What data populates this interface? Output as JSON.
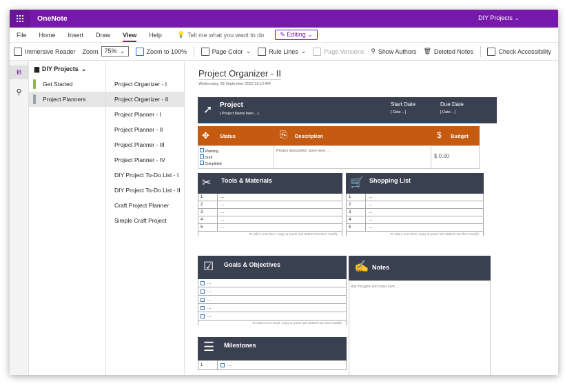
{
  "app": {
    "title": "OneNote",
    "notebook_switch": "DIY Projects"
  },
  "menu": {
    "items": [
      "File",
      "Home",
      "Insert",
      "Draw",
      "View",
      "Help"
    ],
    "active": "View",
    "tellme": "Tell me what you want to do",
    "editing": "Editing"
  },
  "toolbar": {
    "immersive": "Immersive Reader",
    "zoom_label": "Zoom",
    "zoom_value": "75%",
    "zoom100": "Zoom to 100%",
    "page_color": "Page Color",
    "rule_lines": "Rule Lines",
    "page_versions": "Page Versions",
    "show_authors": "Show Authors",
    "deleted_notes": "Deleted Notes",
    "check_access": "Check Accessibility"
  },
  "notebook": {
    "name": "DIY Projects"
  },
  "sections": [
    {
      "label": "Get Started",
      "color": "#8bbd3c"
    },
    {
      "label": "Project Planners",
      "color": "#9aa4b0"
    }
  ],
  "pages": [
    "Project Organizer - I",
    "Project Organizer - II",
    "Project Planner - I",
    "Project Planner - II",
    "Project Planner - III",
    "Project Planner - IV",
    "DIY Project To-Do List - I",
    "DIY Project To-Do List - II",
    "Craft Project Planner",
    "Simple Craft Project"
  ],
  "page": {
    "title": "Project Organizer - II",
    "date": "Wednesday, 28 September 2022    10:12 AM",
    "project": {
      "label": "Project",
      "name_ph": "[ Project Name here .. ]",
      "start_label": "Start Date",
      "start_ph": "[ Date .. ]",
      "due_label": "Due Date",
      "due_ph": "[ Date .. ]"
    },
    "status": {
      "label": "Status",
      "options": [
        "Planning",
        "Draft",
        "Completed"
      ]
    },
    "description": {
      "label": "Description",
      "ph": "Project description goes here ..."
    },
    "budget": {
      "label": "Budget",
      "value": "$ 0.00"
    },
    "tools": {
      "label": "Tools & Materials",
      "rows": [
        "1",
        "2",
        "3",
        "4",
        "5"
      ],
      "tip": "To add a new item: Copy & paste last dotted row then modify"
    },
    "shopping": {
      "label": "Shopping List",
      "rows": [
        "1",
        "2",
        "3",
        "4",
        "5"
      ],
      "tip": "To add a new item: Copy & paste last dotted row then modify"
    },
    "goals": {
      "label": "Goals & Objectives",
      "tip": "To add a new Goal: Copy & paste last dotted row then modify"
    },
    "notes": {
      "label": "Notes",
      "ph": "Any thoughts and notes here ..."
    },
    "milestones": {
      "label": "Milestones",
      "first": "1"
    },
    "dots": "..."
  },
  "colors": {
    "brand": "#7719aa",
    "navy": "#394050",
    "orange": "#c55a11"
  }
}
